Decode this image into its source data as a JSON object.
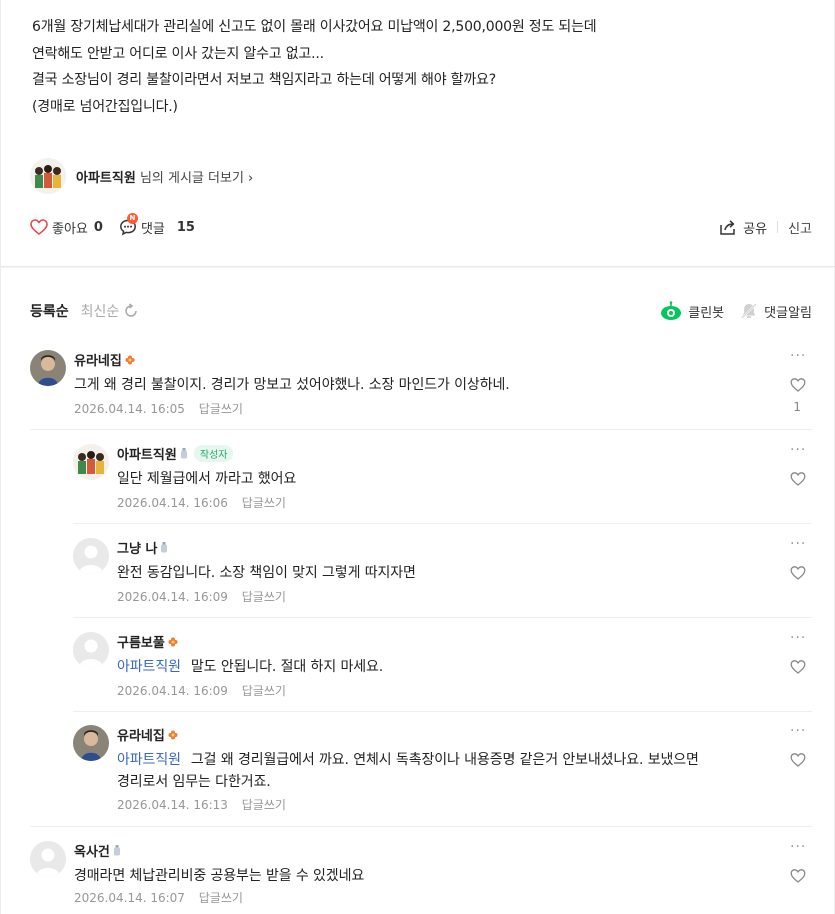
{
  "post": {
    "lines": [
      "6개월 장기체납세대가 관리실에 신고도 없이 몰래 이사갔어요 미납액이 2,500,000원 정도 되는데",
      "연락해도 안받고 어디로 이사 갔는지 알수고 없고...",
      "결국 소장님이 경리 불찰이라면서 저보고 책임지라고 하는데 어떻게 해야 할까요?",
      "(경매로 넘어간집입니다.)"
    ],
    "author_name": "아파트직원",
    "author_more_suffix": "님의 게시글 더보기",
    "author_more_chevron": "›"
  },
  "actions": {
    "like_label": "좋아요",
    "like_count": "0",
    "comment_label": "댓글",
    "comment_count": "15",
    "comment_new_badge": "N",
    "share_label": "공유",
    "report_label": "신고"
  },
  "comment_section": {
    "sort_registered": "등록순",
    "sort_latest": "최신순",
    "cleanbot_label": "클린봇",
    "notify_label": "댓글알림"
  },
  "comments": [
    {
      "nickname": "유라네집",
      "badge": "flower",
      "text": "그게 왜 경리 불찰이지. 경리가 망보고 섰어야했나. 소장 마인드가 이상하네.",
      "date": "2026.04.14. 16:05",
      "reply": "답글쓰기",
      "likes": "1",
      "avatar": "photo",
      "indent": false
    },
    {
      "nickname": "아파트직원",
      "badge": "bottle",
      "writer_tag": "작성자",
      "text": "일단 제월급에서 까라고 했어요",
      "date": "2026.04.14. 16:06",
      "reply": "답글쓰기",
      "avatar": "author",
      "indent": true
    },
    {
      "nickname": "그냥 나",
      "badge": "bottle",
      "text": "완전 동감입니다. 소장 책임이 맞지 그렇게 따지자면",
      "date": "2026.04.14. 16:09",
      "reply": "답글쓰기",
      "avatar": "default",
      "indent": true
    },
    {
      "nickname": "구름보풀",
      "badge": "flower",
      "mention": "아파트직원",
      "text": "말도 안됩니다. 절대 하지 마세요.",
      "date": "2026.04.14. 16:09",
      "reply": "답글쓰기",
      "avatar": "default",
      "indent": true
    },
    {
      "nickname": "유라네집",
      "badge": "flower",
      "mention": "아파트직원",
      "text": "그걸 왜 경리월급에서 까요. 연체시 독촉장이나 내용증명 같은거 안보내셨나요. 보냈으면",
      "text2": "경리로서 임무는 다한거죠.",
      "date": "2026.04.14. 16:13",
      "reply": "답글쓰기",
      "avatar": "photo",
      "indent": true
    },
    {
      "nickname": "옥사건",
      "badge": "bottle",
      "text": "경매라면 체납관리비중 공용부는 받을 수 있겠네요",
      "date": "2026.04.14. 16:07",
      "reply": "답글쓰기",
      "avatar": "default",
      "indent": false
    }
  ],
  "colors": {
    "mention": "#3867c8",
    "accent_green": "#03c75a",
    "heart_red": "#e5484d",
    "new_badge": "#ff5a36",
    "meta_gray": "#979797"
  }
}
